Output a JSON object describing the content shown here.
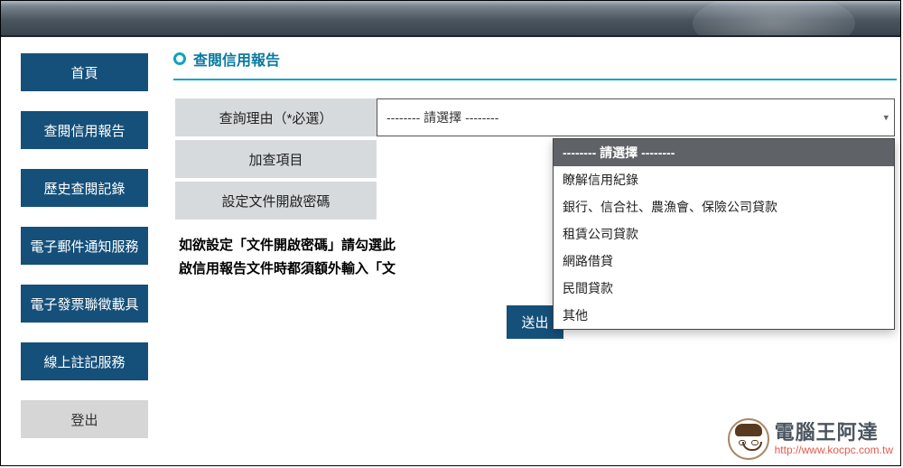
{
  "sidebar": {
    "items": [
      {
        "label": "首頁"
      },
      {
        "label": "查閱信用報告"
      },
      {
        "label": "歷史查閱記錄"
      },
      {
        "label": "電子郵件通知服務"
      },
      {
        "label": "電子發票聯徵載具"
      },
      {
        "label": "線上註記服務"
      },
      {
        "label": "登出"
      }
    ]
  },
  "section": {
    "title": "查閱信用報告"
  },
  "form": {
    "reason_label": "查詢理由（*必選）",
    "addon_label": "加查項目",
    "password_label": "設定文件開啟密碼",
    "select_placeholder": "-------- 請選擇 --------",
    "dropdown": [
      "-------- 請選擇 --------",
      "瞭解信用紀錄",
      "銀行、信合社、農漁會、保險公司貸款",
      "租賃公司貸款",
      "網路借貸",
      "民間貸款",
      "其他"
    ],
    "note_line1": "如欲設定「文件開啟密碼」請勾選此",
    "note_line2": "啟信用報告文件時都須額外輸入「文",
    "submit": "送出"
  },
  "watermark": {
    "name": "電腦王阿達",
    "url": "http://www.kocpc.com.tw"
  }
}
